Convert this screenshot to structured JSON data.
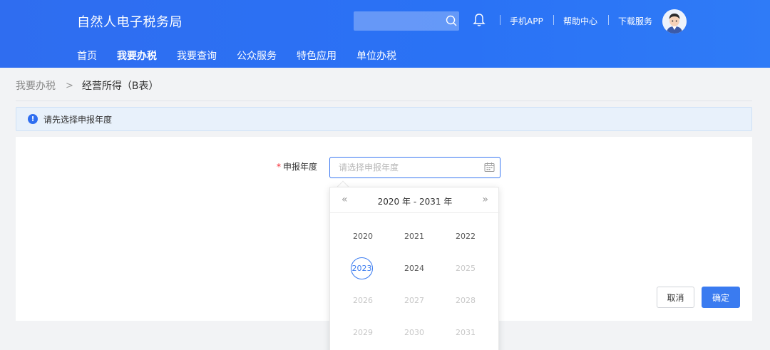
{
  "header": {
    "site_title": "自然人电子税务局",
    "search_placeholder": "",
    "links": {
      "app": "手机APP",
      "help": "帮助中心",
      "download": "下载服务"
    }
  },
  "nav": {
    "items": [
      "首页",
      "我要办税",
      "我要查询",
      "公众服务",
      "特色应用",
      "单位办税"
    ],
    "active": "我要办税"
  },
  "breadcrumb": {
    "root": "我要办税",
    "separator": ">",
    "current": "经营所得（B表）"
  },
  "alert": {
    "text": "请先选择申报年度",
    "icon": "info-icon"
  },
  "form": {
    "label": "申报年度",
    "required_mark": "*",
    "placeholder": "请选择申报年度",
    "icon": "calendar-icon"
  },
  "picker": {
    "prev": "«",
    "next": "»",
    "range": "2020 年 - 2031 年",
    "years": [
      {
        "label": "2020",
        "state": "enabled"
      },
      {
        "label": "2021",
        "state": "enabled"
      },
      {
        "label": "2022",
        "state": "enabled"
      },
      {
        "label": "2023",
        "state": "current"
      },
      {
        "label": "2024",
        "state": "enabled"
      },
      {
        "label": "2025",
        "state": "disabled"
      },
      {
        "label": "2026",
        "state": "disabled"
      },
      {
        "label": "2027",
        "state": "disabled"
      },
      {
        "label": "2028",
        "state": "disabled"
      },
      {
        "label": "2029",
        "state": "disabled"
      },
      {
        "label": "2030",
        "state": "disabled"
      },
      {
        "label": "2031",
        "state": "disabled"
      }
    ]
  },
  "buttons": {
    "cancel": "取消",
    "ok": "确定"
  },
  "colors": {
    "primary": "#3a7bf0",
    "header": "#2f6df0",
    "required": "#f5222d",
    "alert_bg": "#e8f1fb"
  }
}
